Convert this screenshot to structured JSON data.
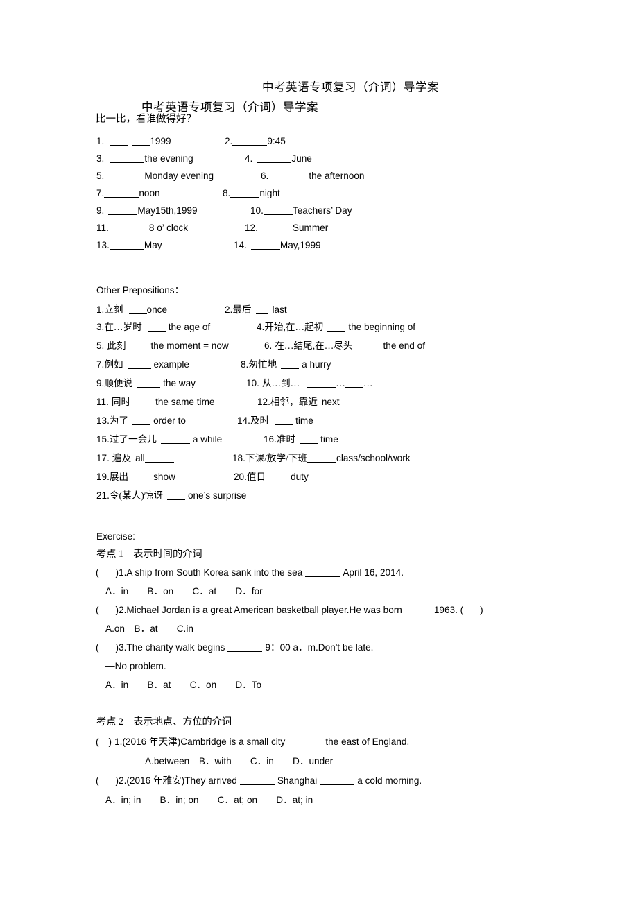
{
  "document": {
    "title_line_1": "中考英语专项复习（介词）导学案",
    "title_line_2": "中考英语专项复习（介词）导学案",
    "prompt": "比一比，看谁做得好？"
  },
  "time_prepositions": {
    "items": [
      {
        "num": "1.",
        "blank": "b3",
        "blank2": "b3",
        "text": "1999"
      },
      {
        "num": "2.",
        "blank": "b6",
        "text": "9:45"
      },
      {
        "num": "3.",
        "blank": "b6",
        "text": "the evening"
      },
      {
        "num": "4.",
        "blank": "b6",
        "text": "June"
      },
      {
        "num": "5.",
        "blank": "b7",
        "text": "Monday evening"
      },
      {
        "num": "6.",
        "blank": "b7",
        "text": "the afternoon"
      },
      {
        "num": "7.",
        "blank": "b6",
        "text": "noon"
      },
      {
        "num": "8.",
        "blank": "b5",
        "text": "night"
      },
      {
        "num": "9.",
        "blank": "b5",
        "text": "May15th,1999"
      },
      {
        "num": "10.",
        "blank": "b5",
        "text": "Teachers’ Day"
      },
      {
        "num": "11.",
        "blank": "b6",
        "text": "8 o’ clock"
      },
      {
        "num": "12.",
        "blank": "b6",
        "text": "Summer"
      },
      {
        "num": "13.",
        "blank": "b6",
        "text": "May"
      },
      {
        "num": "14.",
        "blank": "b5",
        "text": "May,1999"
      }
    ]
  },
  "other_prepositions": {
    "heading": "Other Prepositions：",
    "items": [
      {
        "num": "1.",
        "cn": "立刻",
        "after": "once"
      },
      {
        "num": "2.",
        "cn": "最后",
        "after": "last"
      },
      {
        "num": "3.",
        "cn": "在…岁时",
        "after": "the age of"
      },
      {
        "num": "4.",
        "cn": "开始,在…起初",
        "after": "the beginning of"
      },
      {
        "num": "5.",
        "cn": "此刻",
        "after": "the moment = now"
      },
      {
        "num": "6.",
        "cn": "在…结尾,在…尽头",
        "after": "the end of"
      },
      {
        "num": "7.",
        "cn": "例如",
        "after": "example"
      },
      {
        "num": "8.",
        "cn": "匆忙地",
        "after": "a hurry"
      },
      {
        "num": "9.",
        "cn": "顺便说",
        "after": "the way"
      },
      {
        "num": "10.",
        "cn": "从…到…",
        "after": "…  …"
      },
      {
        "num": "11.",
        "cn": "同时",
        "after": "the same time"
      },
      {
        "num": "12.",
        "cn": "相邻，靠近",
        "after": "next"
      },
      {
        "num": "13.",
        "cn": "为了",
        "after": "order to"
      },
      {
        "num": "14.",
        "cn": "及时",
        "after": "time"
      },
      {
        "num": "15.",
        "cn": "过了一会儿",
        "after": "a while"
      },
      {
        "num": "16.",
        "cn": "准时",
        "after": "time"
      },
      {
        "num": "17.",
        "cn": "遍及",
        "after": "all"
      },
      {
        "num": "18.",
        "cn": "下课/放学/下班",
        "after": "class/school/work"
      },
      {
        "num": "19.",
        "cn": "展出",
        "after": "show"
      },
      {
        "num": "20.",
        "cn": "值日",
        "after": "duty"
      },
      {
        "num": "21.",
        "cn": "令(某人)惊讶",
        "after": "one’s surprise"
      }
    ]
  },
  "exercise": {
    "label": "Exercise:",
    "section_1": {
      "heading": "考点 1　表示时间的介词",
      "questions": [
        {
          "bracket_open": "(",
          "bracket_close": ")",
          "stem_prefix": "1.A ship from South Korea sank into the sea",
          "stem_suffix": "April 16, 2014.",
          "options": "A．in　　B．on　　C．at　　D．for"
        },
        {
          "bracket_open": "(",
          "bracket_close": ")",
          "stem_prefix": "2.Michael Jordan is a great American basketball player.He was born",
          "stem_suffix": "1963. (",
          "stem_tail": ")",
          "options": "A.on　B．at　　C.in"
        },
        {
          "bracket_open": "(",
          "bracket_close": ")",
          "stem_prefix": "3.The charity walk begins",
          "stem_suffix": "9：00 a．m.Don't be late.",
          "reply": "—No problem.",
          "options": "A．in　　B．at　　C．on　　D．To"
        }
      ]
    },
    "section_2": {
      "heading": "考点 2　表示地点、方位的介词",
      "questions": [
        {
          "bracket_open": "(",
          "bracket_close": ")",
          "stem_prefix": "1.(2016 年天津)Cambridge is a small city",
          "stem_suffix": "the east of England.",
          "options": "A.between　B．with　　C．in　　D．under"
        },
        {
          "bracket_open": "(",
          "bracket_close": ")",
          "stem_prefix": "2.(2016 年雅安)They arrived",
          "stem_mid": "Shanghai",
          "stem_suffix": "a cold morning.",
          "options": "A．in; in　　B．in; on　　C．at; on　　D．at; in"
        }
      ]
    }
  }
}
